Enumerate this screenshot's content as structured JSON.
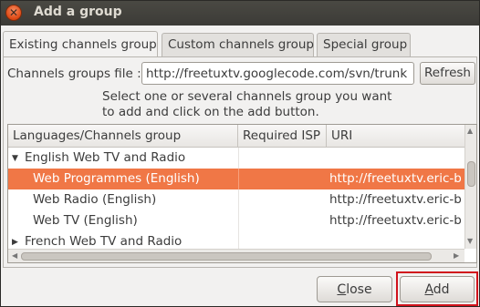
{
  "window": {
    "title": "Add a group"
  },
  "tabs": [
    {
      "label": "Existing channels group",
      "active": true
    },
    {
      "label": "Custom channels group",
      "active": false
    },
    {
      "label": "Special group",
      "active": false
    }
  ],
  "file": {
    "label": "Channels groups file :",
    "value": "http://freetuxtv.googlecode.com/svn/trunk",
    "refresh_label": "Refresh"
  },
  "hint": {
    "line1": "Select one or several channels group you want",
    "line2": "to add and click on the add button."
  },
  "tree": {
    "columns": [
      "Languages/Channels group",
      "Required ISP",
      "URI"
    ],
    "rows": [
      {
        "name": "English Web TV and Radio",
        "isp": "",
        "uri": "",
        "expander": "▼",
        "level": 0,
        "selected": false
      },
      {
        "name": "Web Programmes (English)",
        "isp": "",
        "uri": "http://freetuxtv.eric-b",
        "expander": "",
        "level": 1,
        "selected": true
      },
      {
        "name": "Web Radio (English)",
        "isp": "",
        "uri": "http://freetuxtv.eric-b",
        "expander": "",
        "level": 1,
        "selected": false
      },
      {
        "name": "Web TV (English)",
        "isp": "",
        "uri": "http://freetuxtv.eric-b",
        "expander": "",
        "level": 1,
        "selected": false
      },
      {
        "name": "French Web TV and Radio",
        "isp": "",
        "uri": "",
        "expander": "▶",
        "level": 0,
        "selected": false
      }
    ]
  },
  "buttons": {
    "close_first": "C",
    "close_rest": "lose",
    "add_first": "A",
    "add_rest": "dd"
  },
  "colors": {
    "selection": "#f07746",
    "highlight_box": "#d1121c"
  }
}
